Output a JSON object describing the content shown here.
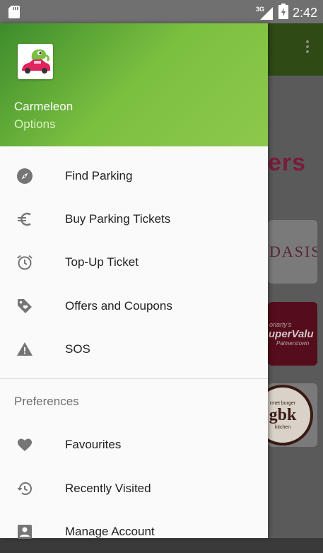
{
  "status_bar": {
    "network": "3G",
    "time": "2:42",
    "icons": [
      "sd-card-icon",
      "signal-icon",
      "battery-icon"
    ]
  },
  "background": {
    "heading_fragment": "ers",
    "cards": [
      {
        "text": "DASIS"
      },
      {
        "line1": "oriarty's",
        "line2": "uperValu",
        "line3": "Palmerstown"
      },
      {
        "top": "rmet burger",
        "logo": "gbk",
        "bottom": "kitchen"
      }
    ]
  },
  "drawer": {
    "header": {
      "title": "Carmeleon",
      "subtitle": "Options",
      "gradient_start": "#3c8c2c",
      "gradient_end": "#8cc84c"
    },
    "items": [
      {
        "label": "Find Parking",
        "icon": "compass-icon"
      },
      {
        "label": "Buy Parking Tickets",
        "icon": "euro-icon"
      },
      {
        "label": "Top-Up Ticket",
        "icon": "alarm-clock-icon"
      },
      {
        "label": "Offers and Coupons",
        "icon": "tag-icon"
      },
      {
        "label": "SOS",
        "icon": "warning-icon"
      }
    ],
    "preferences": {
      "header": "Preferences",
      "items": [
        {
          "label": "Favourites",
          "icon": "heart-icon"
        },
        {
          "label": "Recently Visited",
          "icon": "history-icon"
        },
        {
          "label": "Manage Account",
          "icon": "account-box-icon"
        }
      ]
    }
  }
}
